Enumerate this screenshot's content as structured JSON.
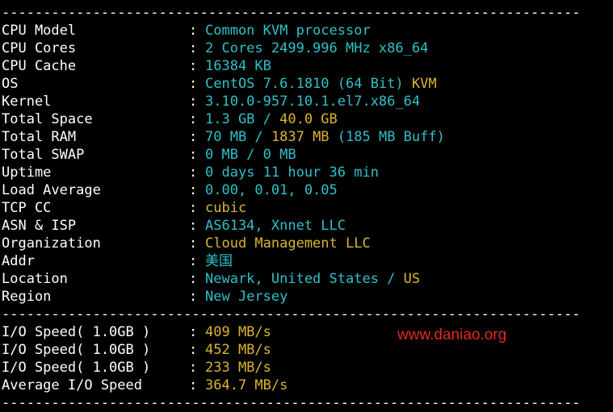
{
  "colors": {
    "background": "#000000",
    "label": "#ffffff",
    "cyan": "#2ec0c8",
    "yellow": "#d9b530",
    "watermark": "#e8281c"
  },
  "separator": "----------------------------------------------------------------------",
  "colon": ":",
  "system_info": [
    {
      "label": "CPU Model",
      "parts": [
        {
          "text": "Common KVM processor",
          "color": "cyan"
        }
      ]
    },
    {
      "label": "CPU Cores",
      "parts": [
        {
          "text": "2 Cores 2499.996 MHz x86_64",
          "color": "cyan"
        }
      ]
    },
    {
      "label": "CPU Cache",
      "parts": [
        {
          "text": "16384 KB",
          "color": "cyan"
        }
      ]
    },
    {
      "label": "OS",
      "parts": [
        {
          "text": "CentOS 7.6.1810 (64 Bit) ",
          "color": "cyan"
        },
        {
          "text": "KVM",
          "color": "yellow"
        }
      ]
    },
    {
      "label": "Kernel",
      "parts": [
        {
          "text": "3.10.0-957.10.1.el7.x86_64",
          "color": "cyan"
        }
      ]
    },
    {
      "label": "Total Space",
      "parts": [
        {
          "text": "1.3 GB / ",
          "color": "cyan"
        },
        {
          "text": "40.0 GB",
          "color": "yellow"
        }
      ]
    },
    {
      "label": "Total RAM",
      "parts": [
        {
          "text": "70 MB / ",
          "color": "cyan"
        },
        {
          "text": "1837 MB",
          "color": "yellow"
        },
        {
          "text": " (185 MB Buff)",
          "color": "cyan"
        }
      ]
    },
    {
      "label": "Total SWAP",
      "parts": [
        {
          "text": "0 MB / 0 MB",
          "color": "cyan"
        }
      ]
    },
    {
      "label": "Uptime",
      "parts": [
        {
          "text": "0 days 11 hour 36 min",
          "color": "cyan"
        }
      ]
    },
    {
      "label": "Load Average",
      "parts": [
        {
          "text": "0.00, 0.01, 0.05",
          "color": "cyan"
        }
      ]
    },
    {
      "label": "TCP CC",
      "parts": [
        {
          "text": "cubic",
          "color": "yellow"
        }
      ]
    },
    {
      "label": "ASN & ISP",
      "parts": [
        {
          "text": "AS6134, Xnnet LLC",
          "color": "cyan"
        }
      ]
    },
    {
      "label": "Organization",
      "parts": [
        {
          "text": "Cloud Management LLC",
          "color": "yellow"
        }
      ]
    },
    {
      "label": "Addr",
      "parts": [
        {
          "text": "美国",
          "color": "cyan"
        }
      ]
    },
    {
      "label": "Location",
      "parts": [
        {
          "text": "Newark, United States / ",
          "color": "cyan"
        },
        {
          "text": "US",
          "color": "yellow"
        }
      ]
    },
    {
      "label": "Region",
      "parts": [
        {
          "text": "New Jersey",
          "color": "cyan"
        }
      ]
    }
  ],
  "io_info": [
    {
      "label": "I/O Speed( 1.0GB )",
      "parts": [
        {
          "text": "409 MB/s",
          "color": "yellow"
        }
      ]
    },
    {
      "label": "I/O Speed( 1.0GB )",
      "parts": [
        {
          "text": "452 MB/s",
          "color": "yellow"
        }
      ]
    },
    {
      "label": "I/O Speed( 1.0GB )",
      "parts": [
        {
          "text": "233 MB/s",
          "color": "yellow"
        }
      ]
    },
    {
      "label": "Average I/O Speed",
      "parts": [
        {
          "text": "364.7 MB/s",
          "color": "yellow"
        }
      ]
    }
  ],
  "watermark": "www.daniao.org"
}
